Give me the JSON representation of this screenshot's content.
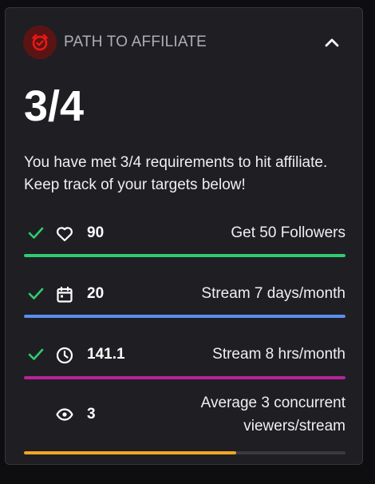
{
  "header": {
    "title": "PATH TO AFFILIATE",
    "badge_icon": "affiliate-badge-icon",
    "badge_color": "#e91916",
    "collapse_icon": "chevron-up-icon"
  },
  "progress": {
    "count": "3/4",
    "description": "You have met 3/4 requirements to hit affiliate. Keep track of your targets below!"
  },
  "requirements": [
    {
      "icon": "heart-icon",
      "value": "90",
      "label": "Get 50 Followers",
      "met": true,
      "progress": 1.0,
      "color": "#2ecc71"
    },
    {
      "icon": "calendar-icon",
      "value": "20",
      "label": "Stream 7 days/month",
      "met": true,
      "progress": 1.0,
      "color": "#5b8def"
    },
    {
      "icon": "clock-icon",
      "value": "141.1",
      "label": "Stream 8 hrs/month",
      "met": true,
      "progress": 1.0,
      "color": "#b8239a"
    },
    {
      "icon": "eye-icon",
      "value": "3",
      "label": "Average 3 concurrent viewers/stream",
      "met": false,
      "progress": 0.66,
      "color": "#f5a623"
    }
  ],
  "colors": {
    "check": "#2ecc71",
    "track": "#3a3a3d"
  }
}
